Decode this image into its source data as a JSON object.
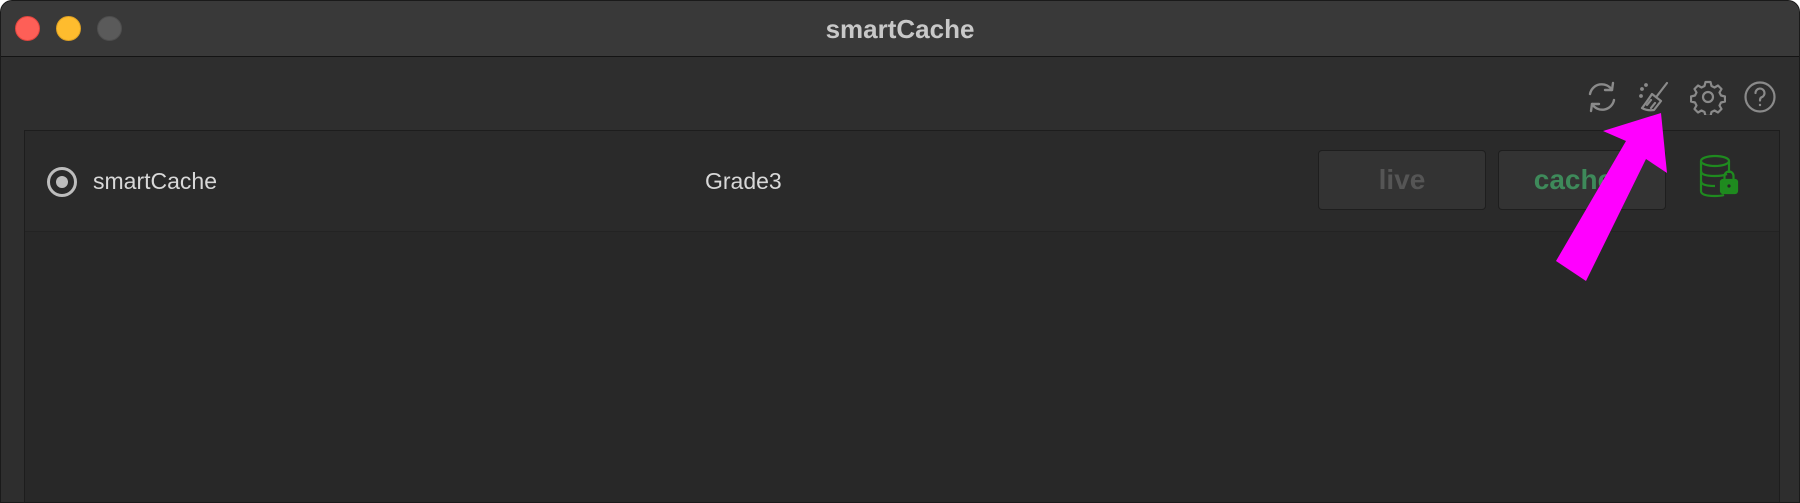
{
  "window": {
    "title": "smartCache"
  },
  "toolbar": {
    "icons": [
      "refresh-icon",
      "broom-icon",
      "gear-icon",
      "help-icon"
    ]
  },
  "list": {
    "rows": [
      {
        "name": "smartCache",
        "grade": "Grade3",
        "live_label": "live",
        "cached_label": "cached",
        "status_icon": "database-lock-icon"
      }
    ]
  },
  "colors": {
    "annotation_arrow": "#ff00ff",
    "cached_text": "#3e8a5a",
    "database_icon": "#1f8a1f"
  }
}
